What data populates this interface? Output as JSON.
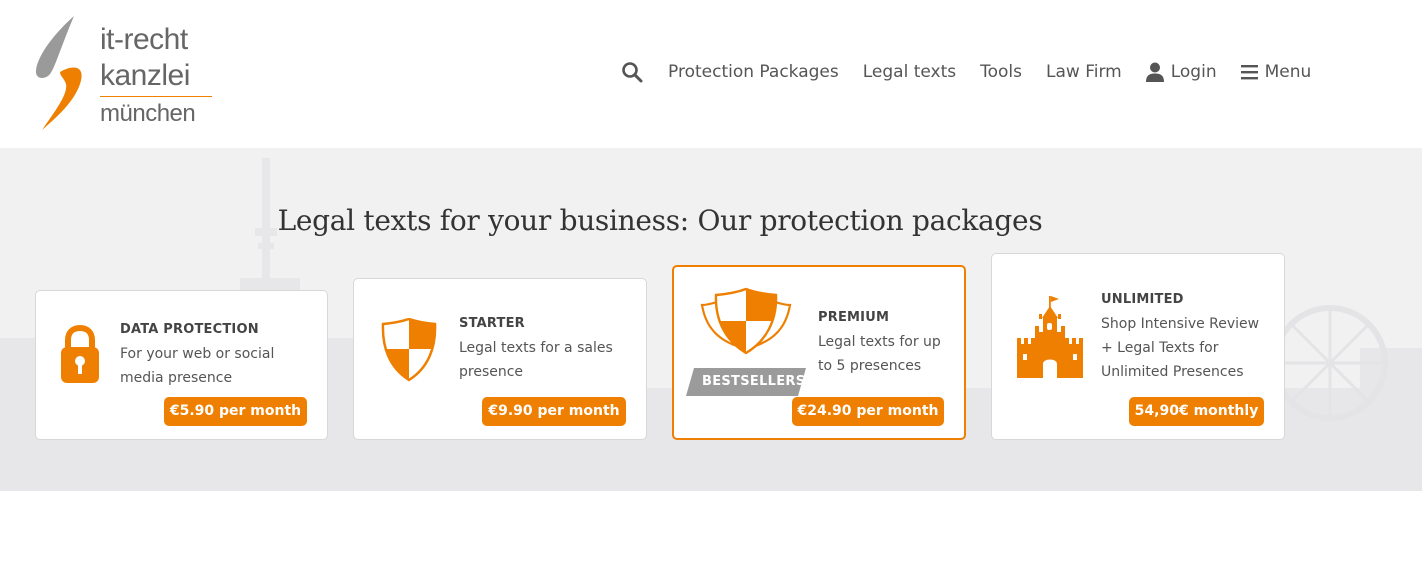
{
  "logo": {
    "line1": "it-recht",
    "line2": "kanzlei",
    "line3": "münchen"
  },
  "nav": {
    "search_icon": "search-icon",
    "items": [
      "Protection Packages",
      "Legal texts",
      "Tools",
      "Law Firm"
    ],
    "login": "Login",
    "menu": "Menu"
  },
  "hero": {
    "title": "Legal texts for your business: Our protection packages"
  },
  "cards": [
    {
      "title": "DATA PROTECTION",
      "desc": "For your web or social media presence",
      "price": "€5.90 per month",
      "icon": "padlock-icon"
    },
    {
      "title": "STARTER",
      "desc": "Legal texts for a sales presence",
      "price": "€9.90 per month",
      "icon": "shield-icon"
    },
    {
      "title": "PREMIUM",
      "desc": "Legal texts for up to 5 presences",
      "price": "€24.90 per month",
      "badge": "BESTSELLERS",
      "icon": "triple-shield-icon"
    },
    {
      "title": "UNLIMITED",
      "desc": "Shop Intensive Review + Legal Texts for Unlimited Presences",
      "price": "54,90€ monthly",
      "icon": "castle-icon"
    }
  ],
  "colors": {
    "accent": "#ee7f00",
    "hero_bg": "#f1f1f2",
    "badge_bg": "#9b9b9b"
  }
}
